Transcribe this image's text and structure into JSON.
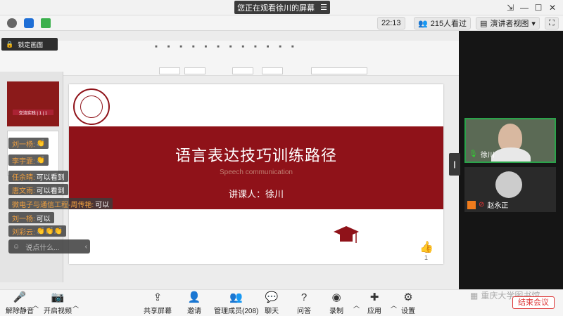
{
  "window": {
    "title": "您正在观看徐川的屏幕",
    "menu_glyph": "☰"
  },
  "meetbar": {
    "time": "22:13",
    "viewers": "215人看过",
    "view_mode": "演讲者视图"
  },
  "lock_screen": "锁定画面",
  "slide": {
    "title": "语言表达技巧训练路径",
    "subtitle": "Speech communication",
    "lecturer": "讲课人：徐川",
    "page": "1"
  },
  "thumb": {
    "label": "交流实践 | 1 | 1"
  },
  "chat": [
    {
      "name": "刘一杨:",
      "text": "👏"
    },
    {
      "name": "李宇霏:",
      "text": "👏"
    },
    {
      "name": "任余晴:",
      "text": "可以看到"
    },
    {
      "name": "唐文雨:",
      "text": "可以看到"
    },
    {
      "name": "微电子与通信工程-周传艳:",
      "text": "可以"
    },
    {
      "name": "刘一杨:",
      "text": "可以"
    },
    {
      "name": "刘彩云:",
      "text": "👏👏👏"
    }
  ],
  "chat_input_placeholder": "说点什么...",
  "participants": [
    {
      "name": "徐川"
    },
    {
      "name": "赵永正"
    }
  ],
  "toolbar": [
    {
      "label": "解除静音",
      "icon": "microphone-icon"
    },
    {
      "label": "开启视频",
      "icon": "camera-icon"
    },
    {
      "label": "共享屏幕",
      "icon": "share-icon"
    },
    {
      "label": "邀请",
      "icon": "invite-icon"
    },
    {
      "label": "管理成员(208)",
      "icon": "members-icon"
    },
    {
      "label": "聊天",
      "icon": "chat-icon"
    },
    {
      "label": "问答",
      "icon": "qa-icon"
    },
    {
      "label": "录制",
      "icon": "record-icon"
    },
    {
      "label": "应用",
      "icon": "apps-icon"
    },
    {
      "label": "设置",
      "icon": "gear-icon"
    }
  ],
  "end_meeting": "结束会议",
  "watermark": "重庆大学图书馆",
  "colors": {
    "brand_red": "#8f1219",
    "speaking_green": "#2aa34a",
    "end_red": "#d33333"
  }
}
